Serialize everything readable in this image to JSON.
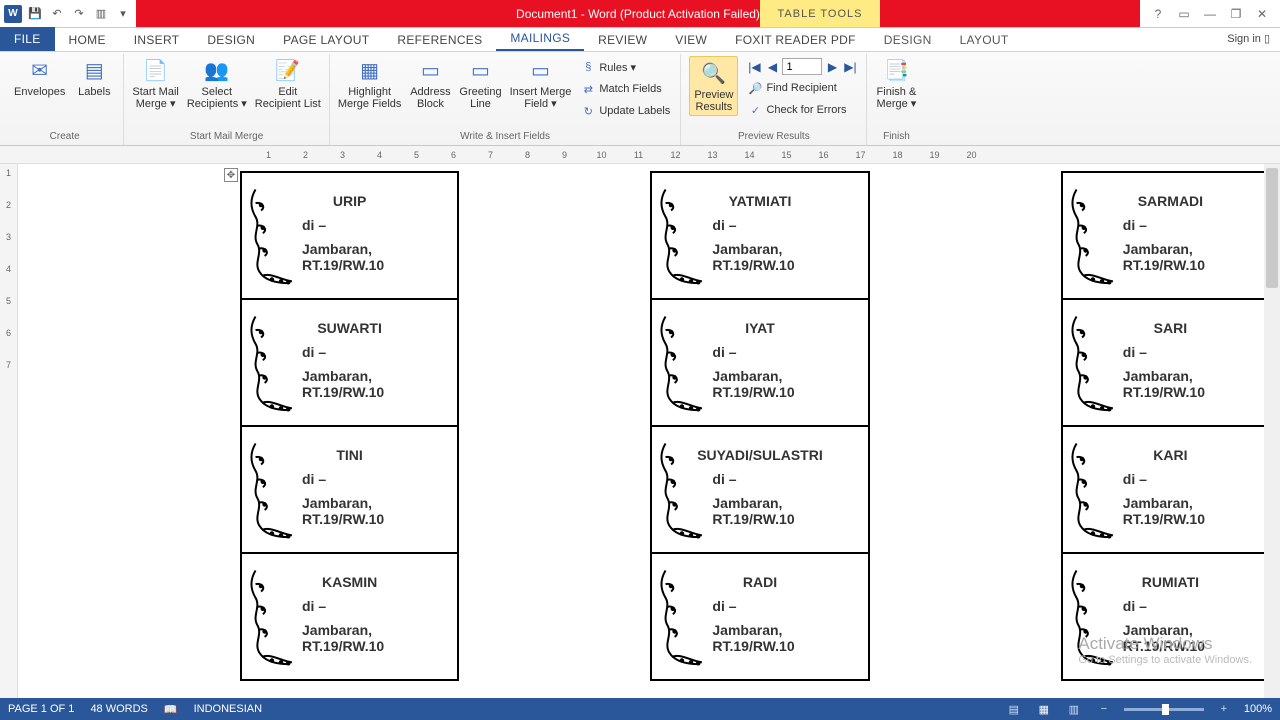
{
  "title": "Document1 - Word (Product Activation Failed)",
  "tabletools_label": "TABLE TOOLS",
  "signin": "Sign in",
  "tabs": {
    "file": "FILE",
    "home": "HOME",
    "insert": "INSERT",
    "design": "DESIGN",
    "pagelayout": "PAGE LAYOUT",
    "references": "REFERENCES",
    "mailings": "MAILINGS",
    "review": "REVIEW",
    "view": "VIEW",
    "foxit": "FOXIT READER PDF",
    "design2": "DESIGN",
    "layout": "LAYOUT"
  },
  "ribbon": {
    "create": {
      "label": "Create",
      "envelopes": "Envelopes",
      "labels": "Labels"
    },
    "startmm": {
      "label": "Start Mail Merge",
      "start": "Start Mail\nMerge ▾",
      "select": "Select\nRecipients ▾",
      "edit": "Edit\nRecipient List"
    },
    "writeins": {
      "label": "Write & Insert Fields",
      "highlight": "Highlight\nMerge Fields",
      "address": "Address\nBlock",
      "greeting": "Greeting\nLine",
      "insertmf": "Insert Merge\nField ▾",
      "rules": "Rules ▾",
      "match": "Match Fields",
      "update": "Update Labels"
    },
    "preview": {
      "label": "Preview Results",
      "btn": "Preview\nResults",
      "record": "1",
      "find": "Find Recipient",
      "check": "Check for Errors"
    },
    "finish": {
      "label": "Finish",
      "btn": "Finish &\nMerge ▾"
    }
  },
  "ruler": [
    "1",
    "2",
    "3",
    "4",
    "5",
    "6",
    "7",
    "8",
    "9",
    "10",
    "11",
    "12",
    "13",
    "14",
    "15",
    "16",
    "17",
    "18",
    "19",
    "20"
  ],
  "vruler": [
    "1",
    "2",
    "3",
    "4",
    "5",
    "6",
    "7"
  ],
  "di_text": "di –",
  "address": "Jambaran, RT.19/RW.10",
  "labels": [
    [
      "URIP",
      "YATMIATI",
      "SARMADI"
    ],
    [
      "SUWARTI",
      "IYAT",
      "SARI"
    ],
    [
      "TINI",
      "SUYADI/SULASTRI",
      "KARI"
    ],
    [
      "KASMIN",
      "RADI",
      "RUMIATI"
    ]
  ],
  "status": {
    "page": "PAGE 1 OF 1",
    "words": "48 WORDS",
    "lang": "INDONESIAN",
    "zoom": "100%"
  },
  "watermark": {
    "l1": "Activate Windows",
    "l2": "Go to Settings to activate Windows."
  }
}
